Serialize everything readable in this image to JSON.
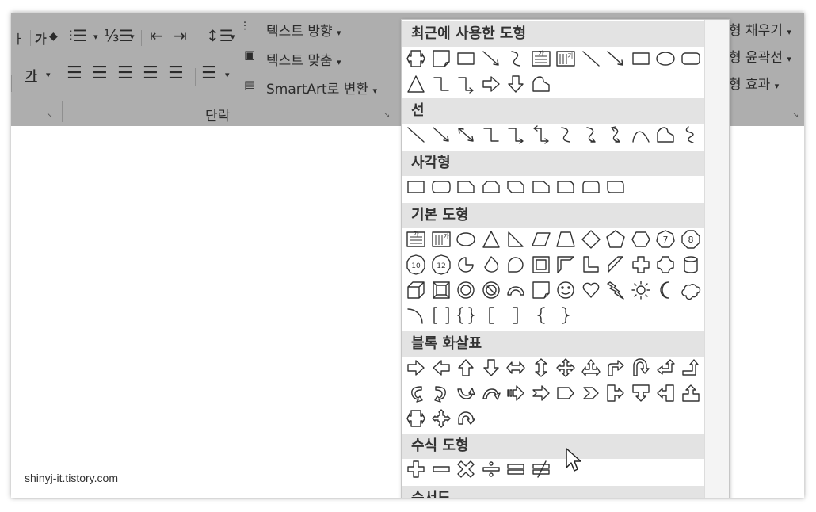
{
  "ribbon": {
    "ga_top": "가",
    "ga_bottom": "가",
    "text_direction": "텍스트 방향",
    "align_text": "텍스트 맞춤",
    "smartart": "SmartArt로 변환",
    "paragraph": "단락",
    "fill_suffix": "형 채우기",
    "outline_suffix": "형 윤곽선",
    "effect_suffix": "형 효과",
    "dropdown": "▾"
  },
  "panel": {
    "sections": {
      "recent": "최근에 사용한 도형",
      "lines": "선",
      "rectangles": "사각형",
      "basic": "기본 도형",
      "block_arrows": "블록 화살표",
      "equation": "수식 도형",
      "flowchart": "순서도"
    },
    "badges": {
      "n10": "10",
      "n12": "12",
      "n7": "7",
      "n8": "8",
      "text_h": "가",
      "text_v": "가"
    }
  },
  "watermark": "shinyj-it.tistory.com",
  "colors": {
    "ribbon_bg": "#aeaeae",
    "section_header": "#e3e3e3",
    "shape_stroke": "#333333"
  }
}
